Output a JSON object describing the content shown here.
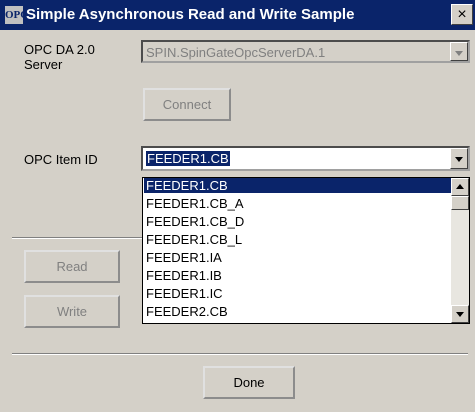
{
  "window": {
    "title": "Simple Asynchronous Read and Write Sample",
    "icon_text": "OPC",
    "close_glyph": "×"
  },
  "server": {
    "label": "OPC DA 2.0\nServer",
    "value": "SPIN.SpinGateOpcServerDA.1",
    "connect_label": "Connect"
  },
  "item": {
    "label": "OPC Item ID",
    "value": "FEEDER1.CB",
    "options": [
      "FEEDER1.CB",
      "FEEDER1.CB_A",
      "FEEDER1.CB_D",
      "FEEDER1.CB_L",
      "FEEDER1.IA",
      "FEEDER1.IB",
      "FEEDER1.IC",
      "FEEDER2.CB"
    ],
    "selected_index": 0
  },
  "buttons": {
    "read_label": "Read",
    "write_label": "Write",
    "done_label": "Done"
  }
}
